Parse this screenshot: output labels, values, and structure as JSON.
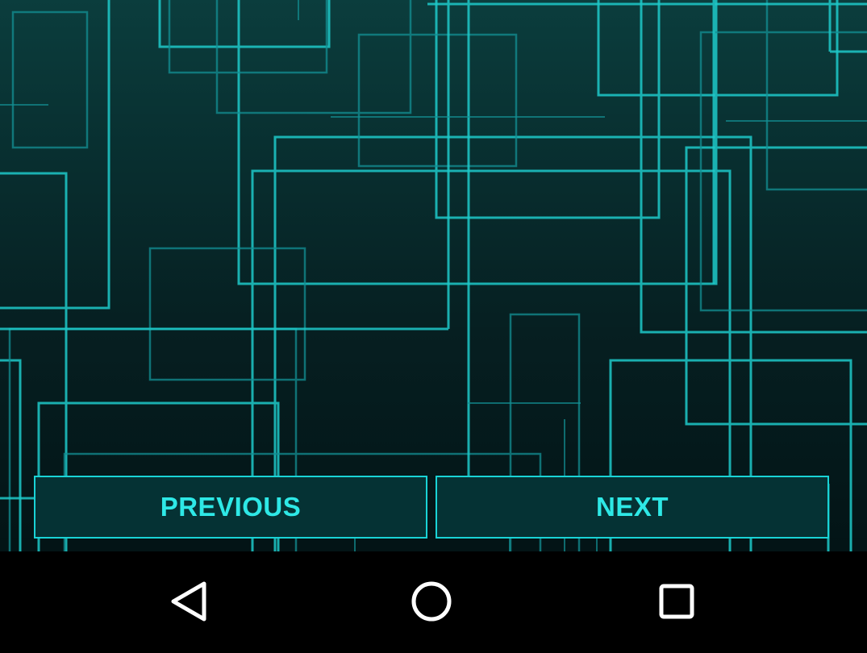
{
  "buttons": {
    "previous_label": "PREVIOUS",
    "next_label": "NEXT"
  },
  "colors": {
    "accent": "#2ee8e6",
    "button_border": "#19d3d6",
    "button_fill": "#053234",
    "nav_bar": "#000000",
    "nav_icon": "#ffffff"
  },
  "navigation_bar": {
    "icons": [
      "back-icon",
      "home-icon",
      "recents-icon"
    ]
  }
}
